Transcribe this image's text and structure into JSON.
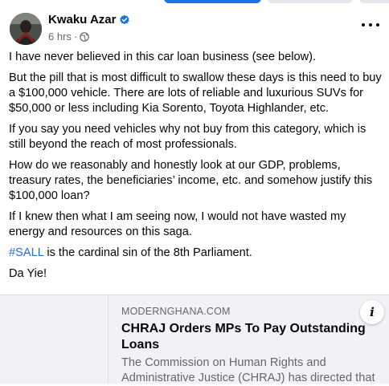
{
  "post": {
    "author": "Kwaku Azar",
    "time": "6 hrs",
    "separator": "·",
    "paragraphs": [
      "I have never believed in this car loan business (see below).",
      "But the pill that is most difficult to swallow these days is this need to buy a $100,000 vehicle. There are lots of reliable and luxurious SUVs for $50,000 or less including Kia Sorento, Toyota Highlander, etc.",
      "If you say you need vehicles why not buy from this category, which is still beyond the reach of most professionals.",
      "How do we reasonably and honestly look at our GDP, problems, treasury rates, the beneficiaries’ income, etc.  and somehow justify this $100,000 loan?",
      "If I knew then what I am seeing now, I would not have wasted my energy and resources on this saga."
    ],
    "hashtag": "#SALL",
    "hashtag_rest": " is the cardinal sin of the 8th Parliament.",
    "closing": "Da Yie!"
  },
  "link": {
    "domain": "MODERNGHANA.COM",
    "title": "CHRAJ Orders MPs To Pay Outstanding Loans",
    "description": "The Commission on Human Rights and Administrative Justice (CHRAJ) has directed that"
  },
  "colors": {
    "accent": "#1b74e4",
    "hashtag": "#216fdb",
    "secondary_text": "#65676b",
    "card_bg": "#f0f2f5"
  },
  "icons": {
    "verified": "verified-badge-icon",
    "audience": "globe-icon",
    "more": "more-options-icon",
    "info": "info-icon"
  }
}
